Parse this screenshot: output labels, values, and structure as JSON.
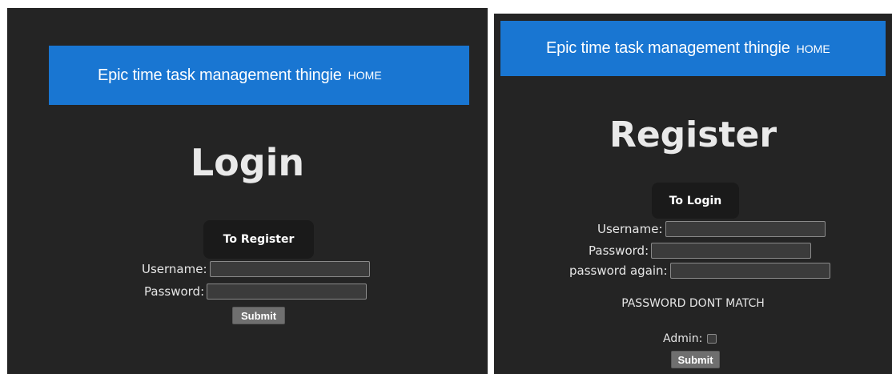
{
  "login": {
    "header": {
      "brand": "Epic time task management thingie",
      "home": "HOME"
    },
    "title": "Login",
    "nav_button": "To Register",
    "fields": {
      "username_label": "Username:",
      "username_value": "",
      "password_label": "Password:",
      "password_value": ""
    },
    "submit": "Submit"
  },
  "register": {
    "header": {
      "brand": "Epic time task management thingie",
      "home": "HOME"
    },
    "title": "Register",
    "nav_button": "To Login",
    "fields": {
      "username_label": "Username:",
      "username_value": "",
      "password_label": "Password:",
      "password_value": "",
      "password_again_label": "password again:",
      "password_again_value": ""
    },
    "error": "PASSWORD DONT MATCH",
    "admin_label": "Admin:",
    "admin_checked": false,
    "submit": "Submit"
  },
  "colors": {
    "header_bg": "#1976d2",
    "panel_bg": "#242424",
    "button_bg": "#1a1a1a"
  }
}
